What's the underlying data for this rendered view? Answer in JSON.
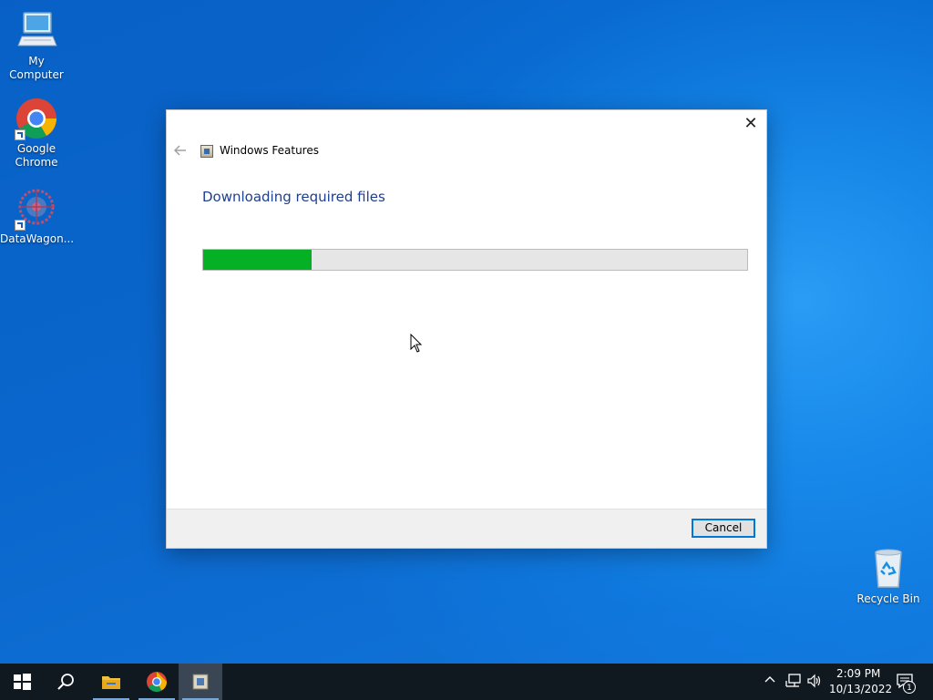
{
  "desktop": {
    "icons": [
      {
        "label": "My Computer",
        "icon": "monitor-icon"
      },
      {
        "label": "Google Chrome",
        "icon": "chrome-icon"
      },
      {
        "label": "DataWagon...",
        "icon": "datawagon-icon"
      },
      {
        "label": "Recycle Bin",
        "icon": "recycle-bin-icon"
      }
    ]
  },
  "dialog": {
    "title": "Windows Features",
    "heading": "Downloading required files",
    "progress_fraction": 0.2,
    "cancel_label": "Cancel",
    "close_glyph": "✕",
    "back_glyph": "🡐"
  },
  "taskbar": {
    "items": [
      "start-icon",
      "search-icon",
      "file-explorer-icon",
      "chrome-icon",
      "windows-features-icon"
    ],
    "clock_time": "2:09 PM",
    "clock_date": "10/13/2022",
    "notification_count": "1"
  },
  "colors": {
    "accent": "#0078d7",
    "progress": "#06b025",
    "heading": "#1e3f8f",
    "taskbar": "#101820"
  }
}
